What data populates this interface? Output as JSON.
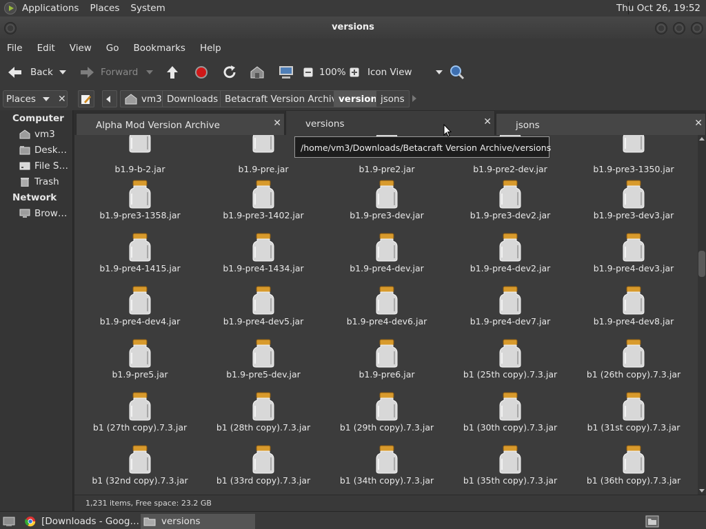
{
  "top_panel": {
    "menus": [
      "Applications",
      "Places",
      "System"
    ],
    "clock": "Thu Oct 26, 19:52"
  },
  "window": {
    "title": "versions"
  },
  "menubar": [
    "File",
    "Edit",
    "View",
    "Go",
    "Bookmarks",
    "Help"
  ],
  "toolbar": {
    "back": "Back",
    "forward": "Forward",
    "zoom": "100%",
    "view_mode": "Icon View"
  },
  "location": {
    "places_label": "Places",
    "crumbs": [
      "vm3",
      "Downloads",
      "Betacraft Version Archive",
      "versions",
      "jsons"
    ]
  },
  "sidebar": {
    "sections": [
      {
        "title": "Computer",
        "items": [
          {
            "label": "vm3",
            "icon": "home-folder-icon"
          },
          {
            "label": "Desk…",
            "icon": "desktop-folder-icon"
          },
          {
            "label": "File S…",
            "icon": "drive-icon"
          },
          {
            "label": "Trash",
            "icon": "trash-icon"
          }
        ]
      },
      {
        "title": "Network",
        "items": [
          {
            "label": "Brow…",
            "icon": "network-icon"
          }
        ]
      }
    ]
  },
  "tabs": [
    {
      "label": "Alpha Mod Version Archive",
      "active": false
    },
    {
      "label": "versions",
      "active": true
    },
    {
      "label": "jsons",
      "active": false
    }
  ],
  "tooltip": "/home/vm3/Downloads/Betacraft Version Archive/versions",
  "files": [
    "b1.9-b-2.jar",
    "b1.9-pre.jar",
    "b1.9-pre2.jar",
    "b1.9-pre2-dev.jar",
    "b1.9-pre3-1350.jar",
    "b1.9-pre3-1358.jar",
    "b1.9-pre3-1402.jar",
    "b1.9-pre3-dev.jar",
    "b1.9-pre3-dev2.jar",
    "b1.9-pre3-dev3.jar",
    "b1.9-pre4-1415.jar",
    "b1.9-pre4-1434.jar",
    "b1.9-pre4-dev.jar",
    "b1.9-pre4-dev2.jar",
    "b1.9-pre4-dev3.jar",
    "b1.9-pre4-dev4.jar",
    "b1.9-pre4-dev5.jar",
    "b1.9-pre4-dev6.jar",
    "b1.9-pre4-dev7.jar",
    "b1.9-pre4-dev8.jar",
    "b1.9-pre5.jar",
    "b1.9-pre5-dev.jar",
    "b1.9-pre6.jar",
    "b1 (25th copy).7.3.jar",
    "b1 (26th copy).7.3.jar",
    "b1 (27th copy).7.3.jar",
    "b1 (28th copy).7.3.jar",
    "b1 (29th copy).7.3.jar",
    "b1 (30th copy).7.3.jar",
    "b1 (31st copy).7.3.jar",
    "b1 (32nd copy).7.3.jar",
    "b1 (33rd copy).7.3.jar",
    "b1 (34th copy).7.3.jar",
    "b1 (35th copy).7.3.jar",
    "b1 (36th copy).7.3.jar"
  ],
  "status": "1,231 items, Free space: 23.2 GB",
  "taskbar": [
    {
      "label": "[Downloads - Goog…",
      "icon": "chrome-icon",
      "active": false
    },
    {
      "label": "versions",
      "icon": "folder-icon",
      "active": true
    }
  ],
  "colors": {
    "jar_lid": "#d89a2c",
    "accent_red": "#d01818"
  }
}
